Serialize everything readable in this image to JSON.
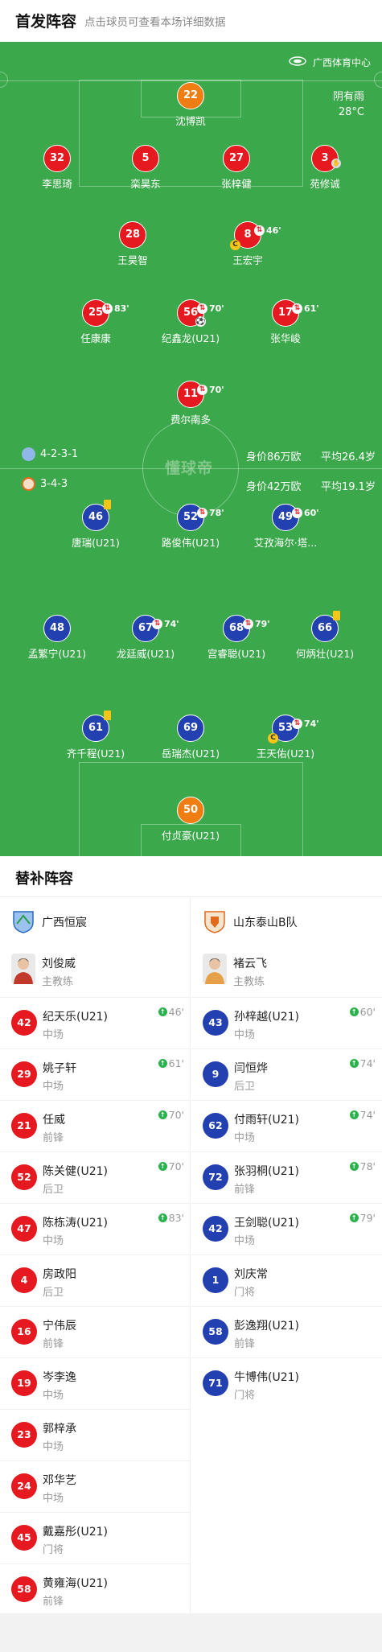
{
  "header": {
    "title": "首发阵容",
    "subtitle": "点击球员可查看本场详细数据"
  },
  "venue": {
    "name": "广西体育中心",
    "weather": "阴有雨",
    "temperature": "28°C"
  },
  "watermark": "懂球帝",
  "teams": {
    "home": {
      "formation": "4-2-3-1",
      "value": "身价86万欧",
      "age": "平均26.4岁",
      "color": "#e5191f"
    },
    "away": {
      "formation": "3-4-3",
      "value": "身价42万欧",
      "age": "平均19.1岁",
      "color": "#2240b0"
    }
  },
  "home_players": [
    {
      "number": "22",
      "name": "沈博凯",
      "gk": true
    },
    {
      "number": "32",
      "name": "李思琦"
    },
    {
      "number": "5",
      "name": "栾昊东"
    },
    {
      "number": "27",
      "name": "张梓健"
    },
    {
      "number": "3",
      "name": "苑修诚",
      "gloves": true
    },
    {
      "number": "28",
      "name": "王昊智"
    },
    {
      "number": "8",
      "name": "王宏宇",
      "sub_off": "46'",
      "captain": true
    },
    {
      "number": "25",
      "name": "任康康",
      "sub_off": "83'"
    },
    {
      "number": "56",
      "name": "纪鑫龙(U21)",
      "sub_off": "70'",
      "goal": true
    },
    {
      "number": "17",
      "name": "张华峻",
      "sub_off": "61'"
    },
    {
      "number": "11",
      "name": "费尔南多",
      "sub_off": "70'"
    }
  ],
  "away_players": [
    {
      "number": "46",
      "name": "唐瑞(U21)",
      "yellow": true
    },
    {
      "number": "52",
      "name": "路俊伟(U21)",
      "sub_off": "78'"
    },
    {
      "number": "49",
      "name": "艾孜海尔·塔...",
      "sub_off": "60'"
    },
    {
      "number": "48",
      "name": "孟繁宁(U21)"
    },
    {
      "number": "67",
      "name": "龙廷威(U21)",
      "sub_off": "74'"
    },
    {
      "number": "68",
      "name": "宫睿聪(U21)",
      "sub_off": "79'"
    },
    {
      "number": "66",
      "name": "何炳壮(U21)",
      "yellow": true
    },
    {
      "number": "61",
      "name": "齐千程(U21)",
      "yellow": true
    },
    {
      "number": "69",
      "name": "岳瑞杰(U21)"
    },
    {
      "number": "53",
      "name": "王天佑(U21)",
      "sub_off": "74'",
      "captain": true
    },
    {
      "number": "50",
      "name": "付贞豪(U21)",
      "gk": true
    }
  ],
  "subs_section": {
    "title": "替补阵容",
    "home": {
      "team_name": "广西恒宸",
      "coach": {
        "name": "刘俊威",
        "role": "主教练"
      },
      "players": [
        {
          "number": "42",
          "name": "纪天乐(U21)",
          "pos": "中场",
          "in": "46'"
        },
        {
          "number": "29",
          "name": "姚子轩",
          "pos": "中场",
          "in": "61'"
        },
        {
          "number": "21",
          "name": "任威",
          "pos": "前锋",
          "in": "70'"
        },
        {
          "number": "52",
          "name": "陈关健(U21)",
          "pos": "后卫",
          "in": "70'"
        },
        {
          "number": "47",
          "name": "陈栋涛(U21)",
          "pos": "中场",
          "in": "83'"
        },
        {
          "number": "4",
          "name": "房政阳",
          "pos": "后卫"
        },
        {
          "number": "16",
          "name": "宁伟辰",
          "pos": "前锋"
        },
        {
          "number": "19",
          "name": "岑李逸",
          "pos": "中场"
        },
        {
          "number": "23",
          "name": "郭梓承",
          "pos": "中场"
        },
        {
          "number": "24",
          "name": "邓华艺",
          "pos": "中场"
        },
        {
          "number": "45",
          "name": "戴嘉彤(U21)",
          "pos": "门将"
        },
        {
          "number": "58",
          "name": "黄雍海(U21)",
          "pos": "前锋"
        }
      ]
    },
    "away": {
      "team_name": "山东泰山B队",
      "coach": {
        "name": "褚云飞",
        "role": "主教练"
      },
      "players": [
        {
          "number": "43",
          "name": "孙梓越(U21)",
          "pos": "中场",
          "in": "60'"
        },
        {
          "number": "9",
          "name": "闫恒烨",
          "pos": "后卫",
          "in": "74'"
        },
        {
          "number": "62",
          "name": "付雨轩(U21)",
          "pos": "中场",
          "in": "74'"
        },
        {
          "number": "72",
          "name": "张羽桐(U21)",
          "pos": "前锋",
          "in": "78'"
        },
        {
          "number": "42",
          "name": "王剑聪(U21)",
          "pos": "中场",
          "in": "79'"
        },
        {
          "number": "1",
          "name": "刘庆常",
          "pos": "门将"
        },
        {
          "number": "58",
          "name": "彭逸翔(U21)",
          "pos": "前锋"
        },
        {
          "number": "71",
          "name": "牛博伟(U21)",
          "pos": "门将"
        }
      ]
    }
  }
}
